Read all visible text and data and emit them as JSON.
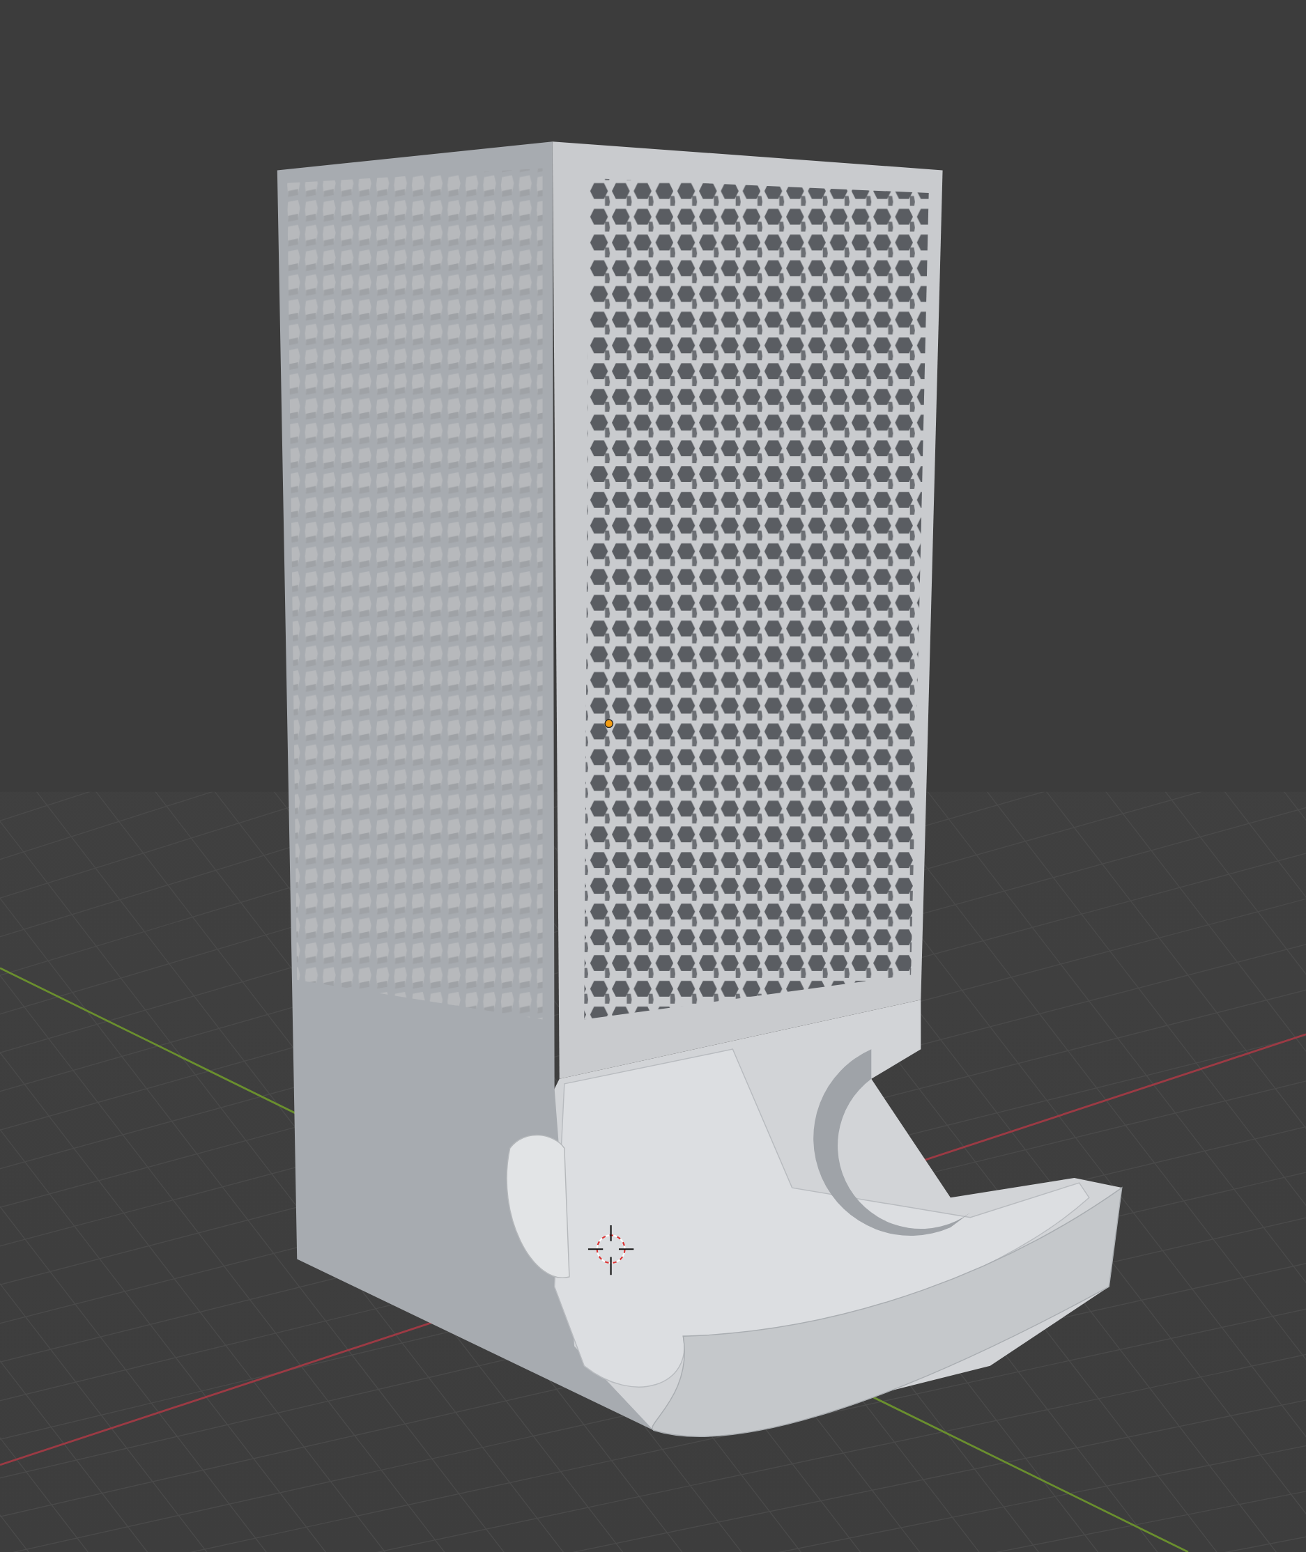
{
  "viewport": {
    "show_floor": true,
    "show_axes": true,
    "show_cursor": true,
    "show_origin": true
  }
}
